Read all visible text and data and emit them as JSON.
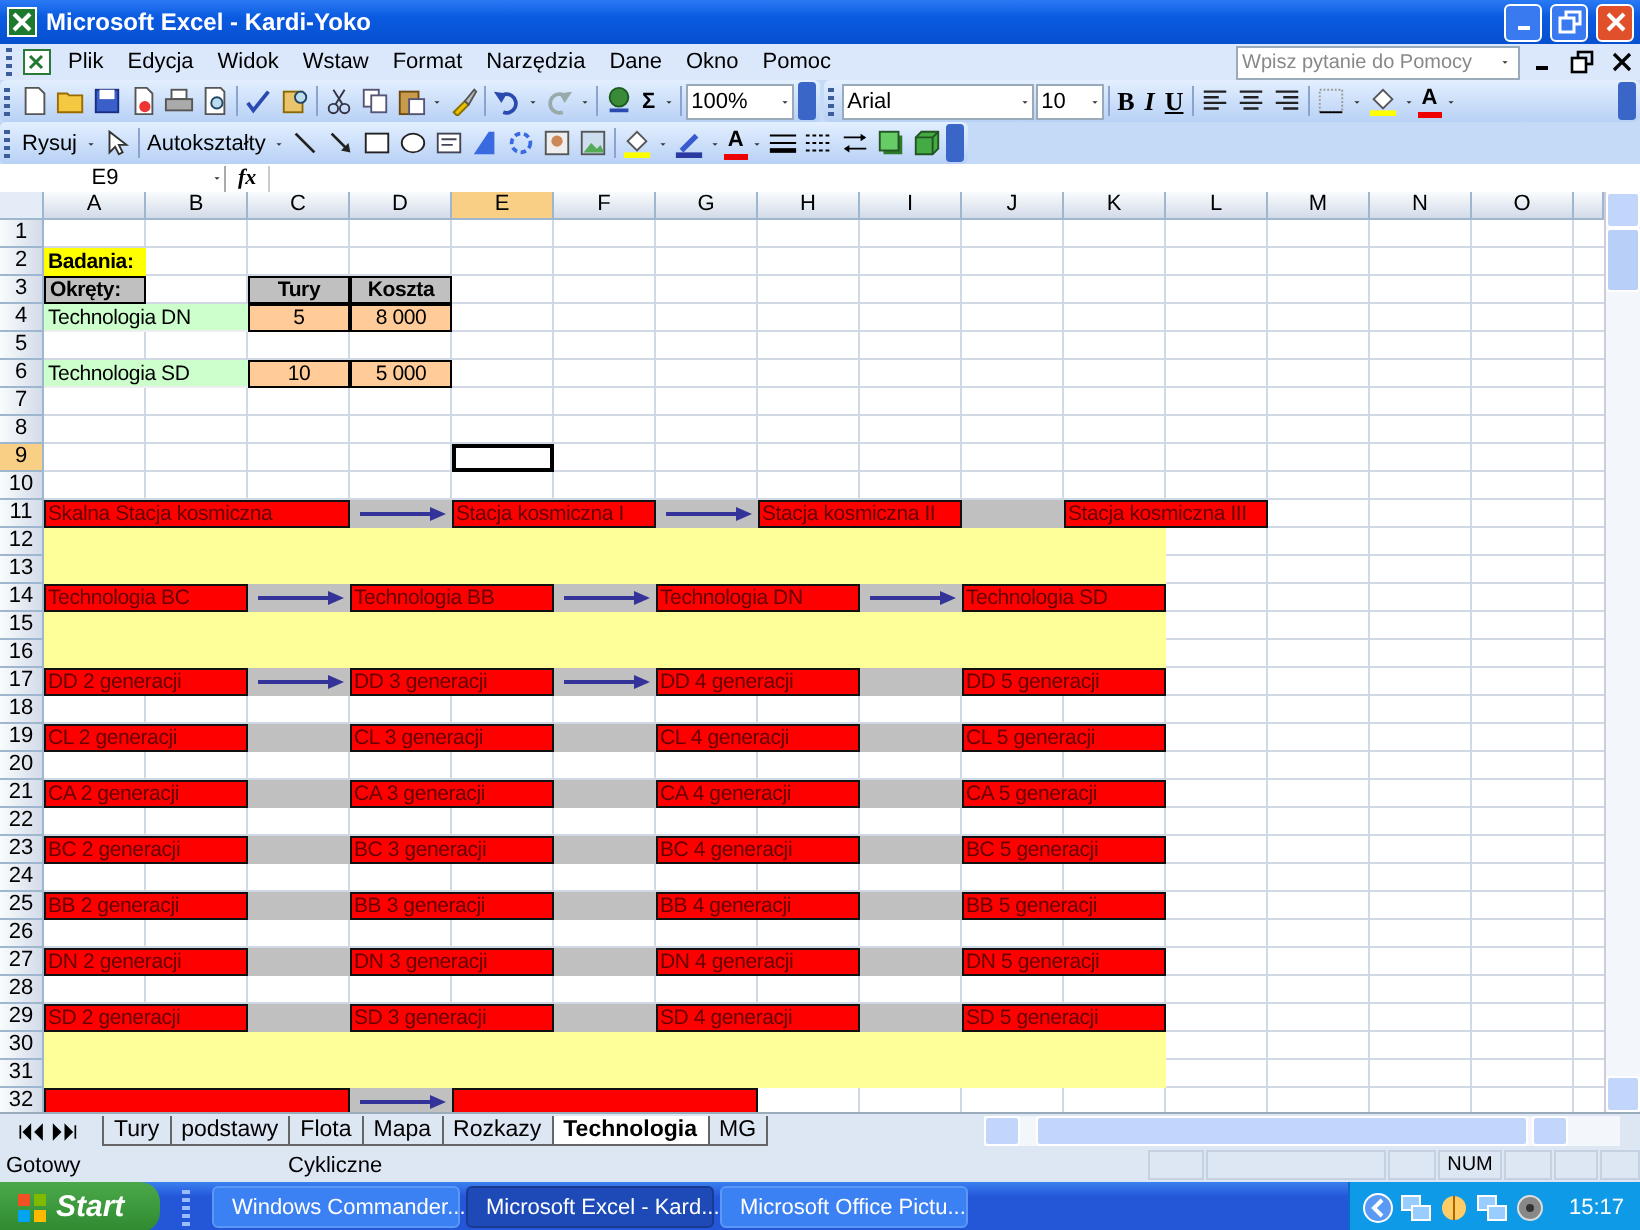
{
  "window": {
    "title": "Microsoft Excel - Kardi-Yoko"
  },
  "menu": [
    "Plik",
    "Edycja",
    "Widok",
    "Wstaw",
    "Format",
    "Narzędzia",
    "Dane",
    "Okno",
    "Pomoc"
  ],
  "help_box": {
    "placeholder": "Wpisz pytanie do Pomocy"
  },
  "toolbar": {
    "sum_label": "Σ",
    "zoom": "100%",
    "font": "Arial",
    "size": "10",
    "bold_label": "B",
    "italic_label": "I",
    "underline_label": "U",
    "font_color_label": "A"
  },
  "drawing_toolbar": {
    "draw_menu": "Rysuj",
    "autoshapes_menu": "Autokształty",
    "font_color_label": "A"
  },
  "formula_bar": {
    "name_box": "E9",
    "fx_label": "fx"
  },
  "sheet": {
    "columns": [
      {
        "label": "A",
        "selected": false
      },
      {
        "label": "B",
        "selected": false
      },
      {
        "label": "C",
        "selected": false
      },
      {
        "label": "D",
        "selected": false
      },
      {
        "label": "E",
        "selected": true
      },
      {
        "label": "F",
        "selected": false
      },
      {
        "label": "G",
        "selected": false
      },
      {
        "label": "H",
        "selected": false
      },
      {
        "label": "I",
        "selected": false
      },
      {
        "label": "J",
        "selected": false
      },
      {
        "label": "K",
        "selected": false
      },
      {
        "label": "L",
        "selected": false
      },
      {
        "label": "M",
        "selected": false
      },
      {
        "label": "N",
        "selected": false
      },
      {
        "label": "O",
        "selected": false
      }
    ],
    "rows": [
      {
        "number": "1",
        "selected": false,
        "highlighted": false
      },
      {
        "number": "2",
        "selected": false,
        "highlighted": false,
        "cells": [
          {
            "kind": "label",
            "text": "Badania:"
          }
        ]
      },
      {
        "number": "3",
        "selected": false,
        "highlighted": false,
        "cells": [
          {
            "kind": "header",
            "text": "Okręty:"
          },
          {
            "kind": "blank"
          },
          {
            "kind": "header",
            "text": "Tury"
          },
          {
            "kind": "header",
            "text": "Koszta"
          }
        ]
      },
      {
        "number": "4",
        "selected": false,
        "highlighted": false,
        "cells": [
          {
            "kind": "name",
            "text": "Technologia DN"
          },
          {
            "kind": "name"
          },
          {
            "kind": "value",
            "text": "5"
          },
          {
            "kind": "value",
            "text": "8 000"
          }
        ]
      },
      {
        "number": "5",
        "selected": false,
        "highlighted": false
      },
      {
        "number": "6",
        "selected": false,
        "highlighted": false,
        "cells": [
          {
            "kind": "name",
            "text": "Technologia SD"
          },
          {
            "kind": "name"
          },
          {
            "kind": "value",
            "text": "10"
          },
          {
            "kind": "value",
            "text": "5 000"
          }
        ]
      },
      {
        "number": "7",
        "selected": false,
        "highlighted": false
      },
      {
        "number": "8",
        "selected": false,
        "highlighted": false
      },
      {
        "number": "9",
        "selected": true,
        "highlighted": false
      },
      {
        "number": "10",
        "selected": false,
        "highlighted": false
      },
      {
        "number": "11",
        "selected": false,
        "highlighted": false,
        "cells": [
          {
            "kind": "process",
            "text": "Skalna Stacja kosmiczna"
          },
          {
            "kind": "process"
          },
          {
            "kind": "process"
          },
          {
            "kind": "link",
            "arrow": true
          },
          {
            "kind": "process",
            "text": "Stacja kosmiczna I"
          },
          {
            "kind": "process"
          },
          {
            "kind": "link",
            "arrow": true
          },
          {
            "kind": "process",
            "text": "Stacja kosmiczna II"
          },
          {
            "kind": "process"
          },
          {
            "kind": "link",
            "arrow": false
          },
          {
            "kind": "process",
            "text": "Stacja kosmiczna III"
          },
          {
            "kind": "process"
          }
        ]
      },
      {
        "number": "12",
        "selected": false,
        "highlighted": true
      },
      {
        "number": "13",
        "selected": false,
        "highlighted": true
      },
      {
        "number": "14",
        "selected": false,
        "highlighted": false,
        "cells": [
          {
            "kind": "process",
            "text": "Technologia BC"
          },
          {
            "kind": "process"
          },
          {
            "kind": "link",
            "arrow": true
          },
          {
            "kind": "process",
            "text": "Technologia BB"
          },
          {
            "kind": "process"
          },
          {
            "kind": "link",
            "arrow": true
          },
          {
            "kind": "process",
            "text": "Technologia DN"
          },
          {
            "kind": "process"
          },
          {
            "kind": "link",
            "arrow": true
          },
          {
            "kind": "process",
            "text": "Technologia SD"
          },
          {
            "kind": "process"
          }
        ]
      },
      {
        "number": "15",
        "selected": false,
        "highlighted": true
      },
      {
        "number": "16",
        "selected": false,
        "highlighted": true
      },
      {
        "number": "17",
        "selected": false,
        "highlighted": false,
        "cells": [
          {
            "kind": "process",
            "text": "DD 2 generacji"
          },
          {
            "kind": "process"
          },
          {
            "kind": "link",
            "arrow": true
          },
          {
            "kind": "process",
            "text": "DD 3 generacji"
          },
          {
            "kind": "process"
          },
          {
            "kind": "link",
            "arrow": true
          },
          {
            "kind": "process",
            "text": "DD 4 generacji"
          },
          {
            "kind": "process"
          },
          {
            "kind": "link",
            "arrow": false
          },
          {
            "kind": "process",
            "text": "DD 5 generacji"
          },
          {
            "kind": "process"
          }
        ]
      },
      {
        "number": "18",
        "selected": false,
        "highlighted": false
      },
      {
        "number": "19",
        "selected": false,
        "highlighted": false,
        "cells": [
          {
            "kind": "process",
            "text": "CL 2 generacji"
          },
          {
            "kind": "process"
          },
          {
            "kind": "link",
            "arrow": false
          },
          {
            "kind": "process",
            "text": "CL 3 generacji"
          },
          {
            "kind": "process"
          },
          {
            "kind": "link",
            "arrow": false
          },
          {
            "kind": "process",
            "text": "CL 4 generacji"
          },
          {
            "kind": "process"
          },
          {
            "kind": "link",
            "arrow": false
          },
          {
            "kind": "process",
            "text": "CL 5 generacji"
          },
          {
            "kind": "process"
          }
        ]
      },
      {
        "number": "20",
        "selected": false,
        "highlighted": false
      },
      {
        "number": "21",
        "selected": false,
        "highlighted": false,
        "cells": [
          {
            "kind": "process",
            "text": "CA 2 generacji"
          },
          {
            "kind": "process"
          },
          {
            "kind": "link",
            "arrow": false
          },
          {
            "kind": "process",
            "text": "CA 3 generacji"
          },
          {
            "kind": "process"
          },
          {
            "kind": "link",
            "arrow": false
          },
          {
            "kind": "process",
            "text": "CA 4 generacji"
          },
          {
            "kind": "process"
          },
          {
            "kind": "link",
            "arrow": false
          },
          {
            "kind": "process",
            "text": "CA 5 generacji"
          },
          {
            "kind": "process"
          }
        ]
      },
      {
        "number": "22",
        "selected": false,
        "highlighted": false
      },
      {
        "number": "23",
        "selected": false,
        "highlighted": false,
        "cells": [
          {
            "kind": "process",
            "text": "BC 2 generacji"
          },
          {
            "kind": "process"
          },
          {
            "kind": "link",
            "arrow": false
          },
          {
            "kind": "process",
            "text": "BC 3 generacji"
          },
          {
            "kind": "process"
          },
          {
            "kind": "link",
            "arrow": false
          },
          {
            "kind": "process",
            "text": "BC 4 generacji"
          },
          {
            "kind": "process"
          },
          {
            "kind": "link",
            "arrow": false
          },
          {
            "kind": "process",
            "text": "BC 5 generacji"
          },
          {
            "kind": "process"
          }
        ]
      },
      {
        "number": "24",
        "selected": false,
        "highlighted": false
      },
      {
        "number": "25",
        "selected": false,
        "highlighted": false,
        "cells": [
          {
            "kind": "process",
            "text": "BB 2 generacji"
          },
          {
            "kind": "process"
          },
          {
            "kind": "link",
            "arrow": false
          },
          {
            "kind": "process",
            "text": "BB 3 generacji"
          },
          {
            "kind": "process"
          },
          {
            "kind": "link",
            "arrow": false
          },
          {
            "kind": "process",
            "text": "BB 4 generacji"
          },
          {
            "kind": "process"
          },
          {
            "kind": "link",
            "arrow": false
          },
          {
            "kind": "process",
            "text": "BB 5 generacji"
          },
          {
            "kind": "process"
          }
        ]
      },
      {
        "number": "26",
        "selected": false,
        "highlighted": false
      },
      {
        "number": "27",
        "selected": false,
        "highlighted": false,
        "cells": [
          {
            "kind": "process",
            "text": "DN 2 generacji"
          },
          {
            "kind": "process"
          },
          {
            "kind": "link",
            "arrow": false
          },
          {
            "kind": "process",
            "text": "DN 3 generacji"
          },
          {
            "kind": "process"
          },
          {
            "kind": "link",
            "arrow": false
          },
          {
            "kind": "process",
            "text": "DN 4 generacji"
          },
          {
            "kind": "process"
          },
          {
            "kind": "link",
            "arrow": false
          },
          {
            "kind": "process",
            "text": "DN 5 generacji"
          },
          {
            "kind": "process"
          }
        ]
      },
      {
        "number": "28",
        "selected": false,
        "highlighted": false
      },
      {
        "number": "29",
        "selected": false,
        "highlighted": false,
        "cells": [
          {
            "kind": "process",
            "text": "SD 2 generacji"
          },
          {
            "kind": "process"
          },
          {
            "kind": "link",
            "arrow": false
          },
          {
            "kind": "process",
            "text": "SD 3 generacji"
          },
          {
            "kind": "process"
          },
          {
            "kind": "link",
            "arrow": false
          },
          {
            "kind": "process",
            "text": "SD 4 generacji"
          },
          {
            "kind": "process"
          },
          {
            "kind": "link",
            "arrow": false
          },
          {
            "kind": "process",
            "text": "SD 5 generacji"
          },
          {
            "kind": "process"
          }
        ]
      },
      {
        "number": "30",
        "selected": false,
        "highlighted": true
      },
      {
        "number": "31",
        "selected": false,
        "highlighted": true
      },
      {
        "number": "32",
        "selected": false,
        "highlighted": false,
        "cells": [
          {
            "kind": "process"
          },
          {
            "kind": "process"
          },
          {
            "kind": "process"
          },
          {
            "kind": "link",
            "arrow": true
          },
          {
            "kind": "process"
          },
          {
            "kind": "process"
          },
          {
            "kind": "process"
          }
        ]
      }
    ]
  },
  "sheet_tabs": [
    {
      "label": "Tury",
      "selected": false
    },
    {
      "label": "podstawy",
      "selected": false
    },
    {
      "label": "Flota",
      "selected": false
    },
    {
      "label": "Mapa",
      "selected": false
    },
    {
      "label": "Rozkazy",
      "selected": false
    },
    {
      "label": "Technologia",
      "selected": true
    },
    {
      "label": "MG",
      "selected": false
    }
  ],
  "status_bar": {
    "status": "Gotowy",
    "circular": "Cykliczne",
    "num": "NUM"
  },
  "taskbar": {
    "start": "Start",
    "tasks": [
      {
        "label": "Windows Commander...",
        "selected": false
      },
      {
        "label": "Microsoft Excel - Kard...",
        "selected": true
      },
      {
        "label": "Microsoft Office Pictu...",
        "selected": false
      }
    ],
    "clock": "15:17"
  }
}
